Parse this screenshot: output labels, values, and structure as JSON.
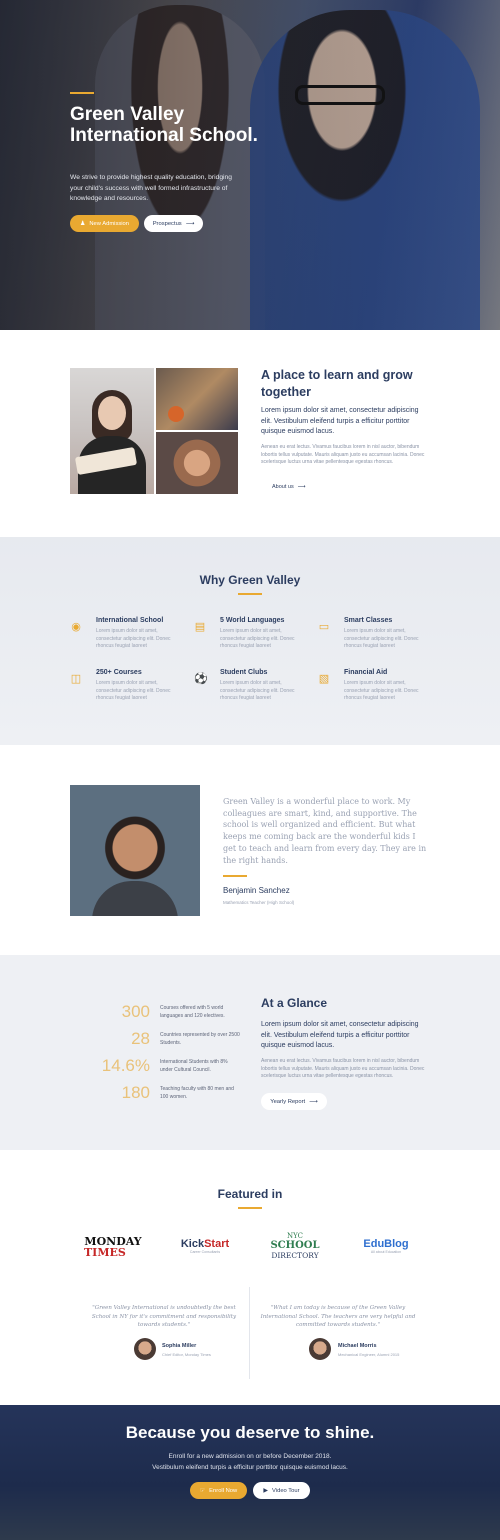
{
  "hero": {
    "title": "Green Valley International School.",
    "text": "We strive to provide highest quality education, bridging your child's success with well formed infrastructure of knowledge and resources.",
    "btn_admission": "New Admission",
    "btn_prospectus": "Prospectus"
  },
  "about": {
    "heading": "A place to learn and grow together",
    "lead": "Lorem ipsum dolor sit amet, consectetur adipiscing elit. Vestibulum eleifend turpis a efficitur porttitor quisque euismod lacus.",
    "body": "Aenean eu erat lectus. Vivamus faucibus lorem in nisl auctor, bibendum lobortis tellus vulputate. Mauris aliquam justo eu accumsan lacinia. Donec scelerisque luctus urna vitae pellentesque egestas rhoncus.",
    "link": "About us"
  },
  "why": {
    "title": "Why Green Valley",
    "features": [
      {
        "title": "International School",
        "desc": "Lorem ipsum dolor sit amet, consectetur adipiscing elit. Donec rhoncus feugiat laoreet",
        "icon": "globe-icon"
      },
      {
        "title": "5 World Languages",
        "desc": "Lorem ipsum dolor sit amet, consectetur adipiscing elit. Donec rhoncus feugiat laoreet",
        "icon": "translate-icon"
      },
      {
        "title": "Smart Classes",
        "desc": "Lorem ipsum dolor sit amet, consectetur adipiscing elit. Donec rhoncus feugiat laoreet",
        "icon": "laptop-icon"
      },
      {
        "title": "250+ Courses",
        "desc": "Lorem ipsum dolor sit amet, consectetur adipiscing elit. Donec rhoncus feugiat laoreet",
        "icon": "book-icon"
      },
      {
        "title": "Student Clubs",
        "desc": "Lorem ipsum dolor sit amet, consectetur adipiscing elit. Donec rhoncus feugiat laoreet",
        "icon": "ball-icon"
      },
      {
        "title": "Financial Aid",
        "desc": "Lorem ipsum dolor sit amet, consectetur adipiscing elit. Donec rhoncus feugiat laoreet",
        "icon": "money-icon"
      }
    ]
  },
  "testimonial": {
    "quote": "Green Valley is a wonderful place to work. My colleagues are smart, kind, and supportive. The school is well organized and efficient. But what keeps me coming back are the wonderful kids I get to teach and learn from every day. They are in the right hands.",
    "name": "Benjamin Sanchez",
    "role": "Mathematics Teacher (High School)"
  },
  "glance": {
    "stats": [
      {
        "number": "300",
        "text": "Courses offered with 5 world languages and 120 electives."
      },
      {
        "number": "28",
        "text": "Countries represented by over 2500 Students."
      },
      {
        "number": "14.6%",
        "text": "International Students with 8% under Cultural Council."
      },
      {
        "number": "180",
        "text": "Teaching faculty with 80 men and 100 women."
      }
    ],
    "heading": "At a Glance",
    "lead": "Lorem ipsum dolor sit amet, consectetur adipiscing elit. Vestibulum eleifend turpis a efficitur porttitor quisque euismod lacus.",
    "body": "Aenean eu erat lectus. Vivamus faucibus lorem in nisl auctor, bibendum lobortis tellus vulputate. Mauris aliquam justo eu accumsan lacinia. Donec scelerisque luctus urna vitae pellentesque egestas rhoncus.",
    "button": "Yearly Report"
  },
  "featured": {
    "title": "Featured in",
    "logos": {
      "monday_1": "MONDAY",
      "monday_2": "TIMES",
      "kick_a": "Kick",
      "kick_b": "Start",
      "kick_sub": "Career Consultants",
      "nyc": "NYC",
      "school": "SCHOOL",
      "directory": "DIRECTORY",
      "edublog": "EduBlog",
      "edublog_sub": "All about Education"
    },
    "testimonials": [
      {
        "quote": "\"Green Valley International is undoubtedly the best School in NY for it's commitment and responsibility towards students.\"",
        "name": "Sophia Miller",
        "role": "Chief Editor, Monday Times"
      },
      {
        "quote": "\"What I am today is because of the Green Valley International School. The teachers are very helpful and committed towards students.\"",
        "name": "Michael Morris",
        "role": "Mechanical Engineer, Alumni 2015"
      }
    ]
  },
  "cta": {
    "title": "Because you deserve to shine.",
    "line1": "Enroll for a new admission on or before December 2018.",
    "line2": "Vestibulum eleifend turpis a efficitur porttitor quisque euismod lacus.",
    "btn_enroll": "Enroll Now",
    "btn_video": "Video Tour"
  },
  "colors": {
    "accent": "#e9a931",
    "navy": "#2c3d60",
    "cta_bg": "#1d2b4c"
  }
}
